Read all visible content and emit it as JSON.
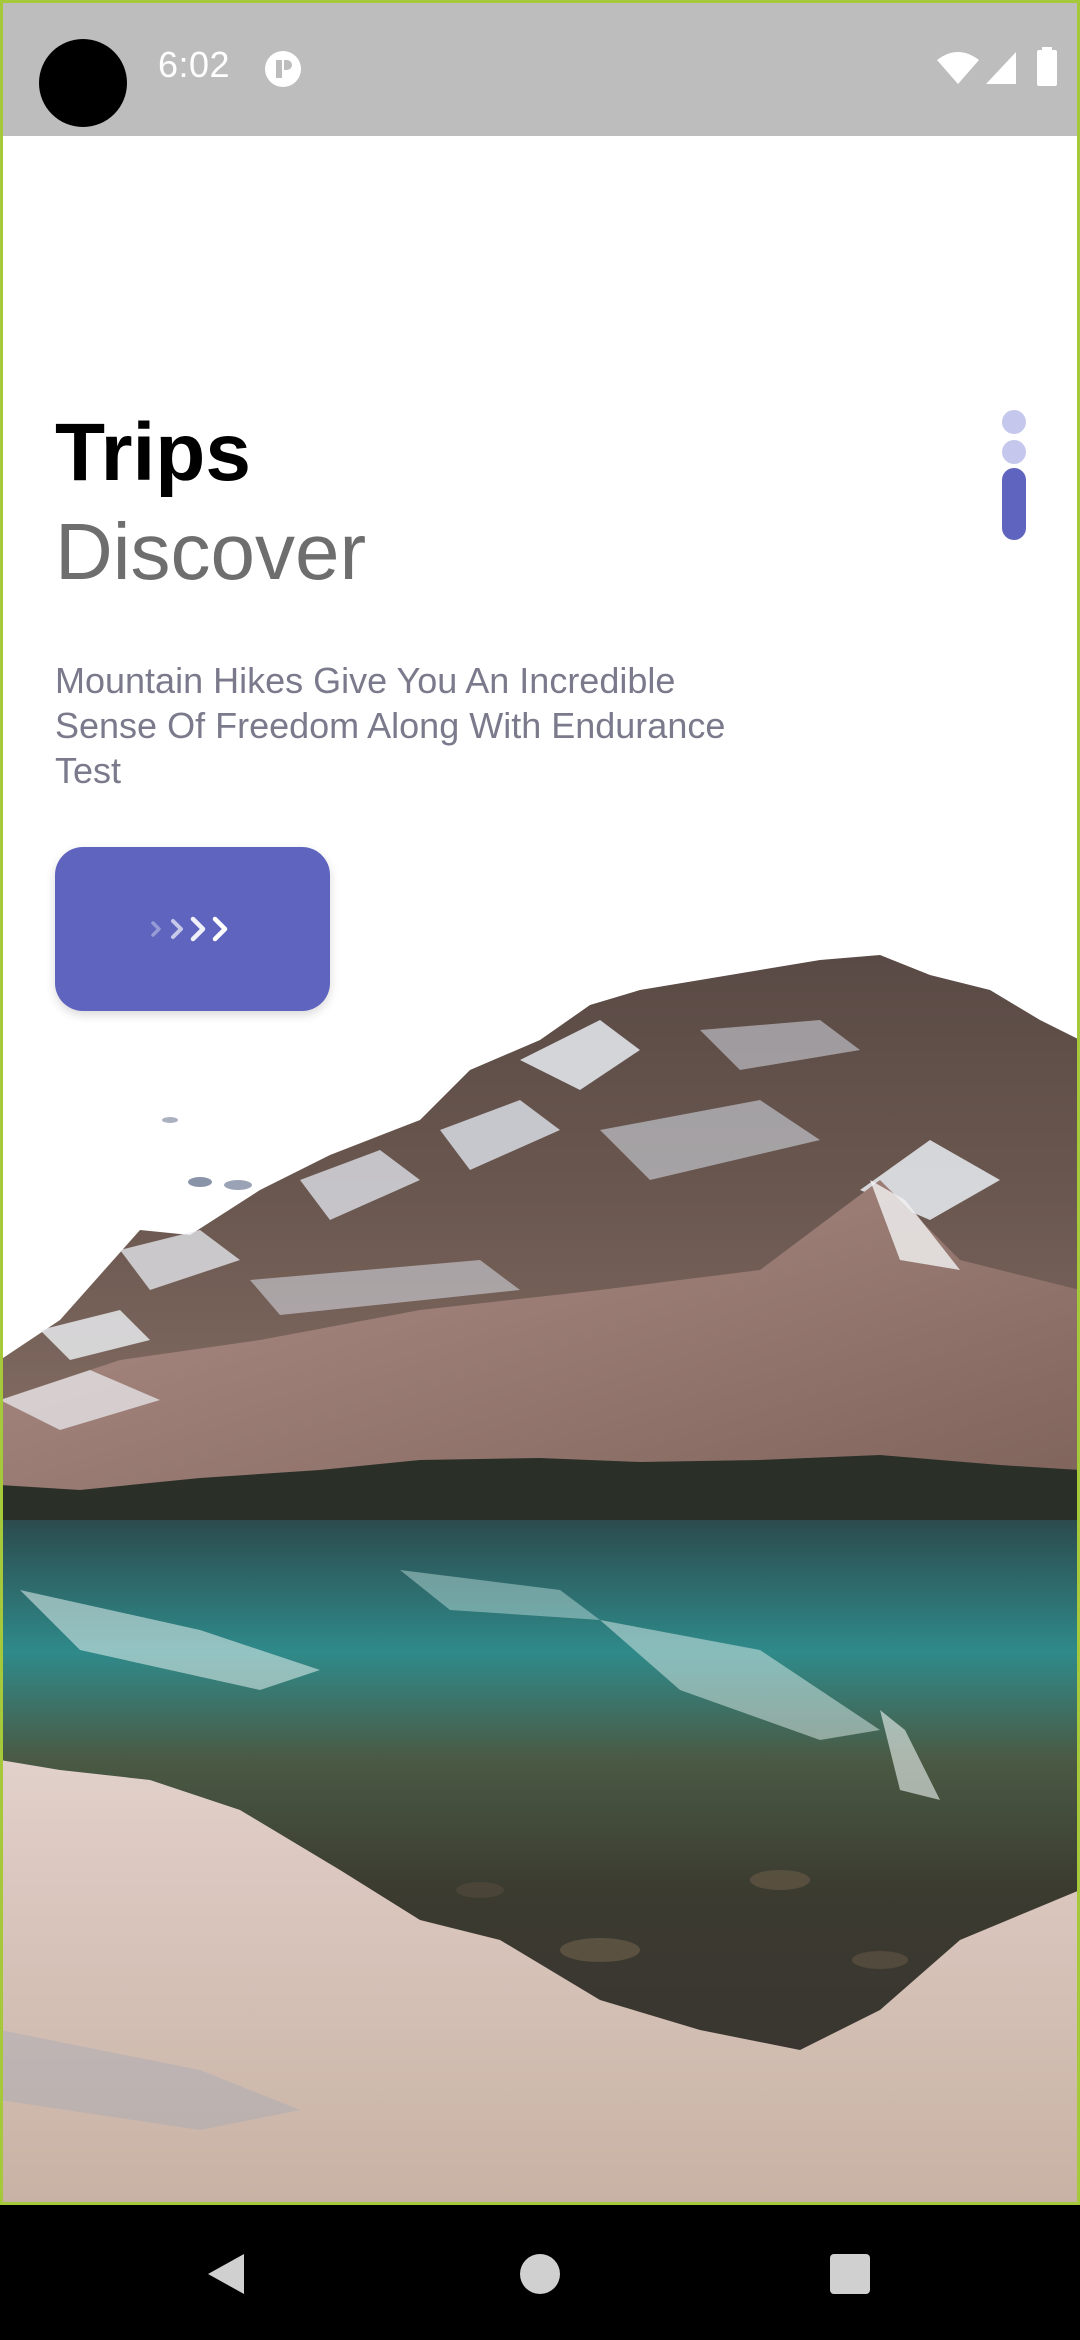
{
  "status_bar": {
    "time": "6:02",
    "icons": [
      "app-notification-icon",
      "wifi-icon",
      "signal-icon",
      "battery-icon"
    ]
  },
  "header": {
    "title": "Trips",
    "subtitle": "Discover"
  },
  "description": "Mountain Hikes Give You An Incredible Sense Of Freedom Along With Endurance Test",
  "next_button": {
    "icon": "chevron-triple-right-icon"
  },
  "page_indicator": {
    "total": 3,
    "active_index": 2
  },
  "hero_image": {
    "subject": "mountain-lake-reflection"
  },
  "nav_bar": {
    "icons": [
      "back-icon",
      "home-icon",
      "recents-icon"
    ]
  },
  "colors": {
    "accent": "#5f64bf",
    "indicator_inactive": "#c5c8ec",
    "status_bar": "#bdbdbd",
    "frame": "#a5c93a"
  }
}
